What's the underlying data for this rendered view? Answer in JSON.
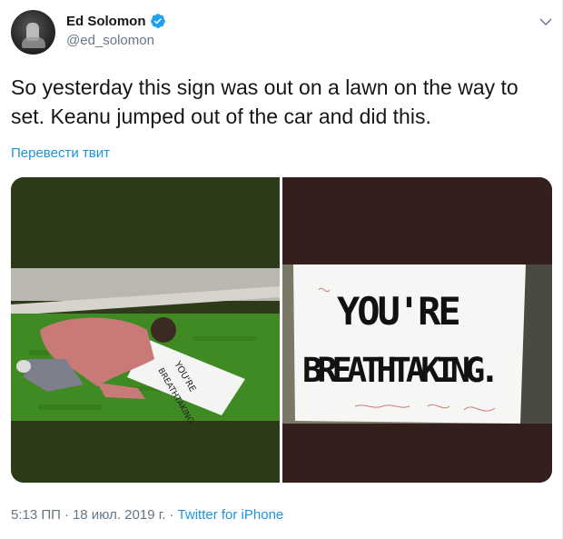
{
  "author": {
    "display_name": "Ed Solomon",
    "handle": "@ed_solomon",
    "avatar_icon": "person-silhouette-avatar",
    "verified_icon": "verified-badge-icon",
    "verified_color": "#1da1f2"
  },
  "tweet": {
    "text": "So yesterday this sign was out on a lawn on the way to set. Keanu jumped out of the car and did this.",
    "translate_label": "Перевести твит"
  },
  "media": {
    "photos": [
      {
        "name": "photo-man-signing-sign-on-lawn",
        "sign_text": [
          "YOU'RE",
          "BREATHTAKING"
        ]
      },
      {
        "name": "photo-breathtaking-sign",
        "sign_text": [
          "YOU'RE",
          "BREATHTAKING."
        ]
      }
    ]
  },
  "meta": {
    "time": "5:13 ПП",
    "separator": "·",
    "date": "18 июл. 2019 г.",
    "separator2": "·",
    "source": "Twitter for iPhone"
  },
  "colors": {
    "link": "#1b95e0",
    "secondary_text": "#657786",
    "primary_text": "#14171a"
  }
}
